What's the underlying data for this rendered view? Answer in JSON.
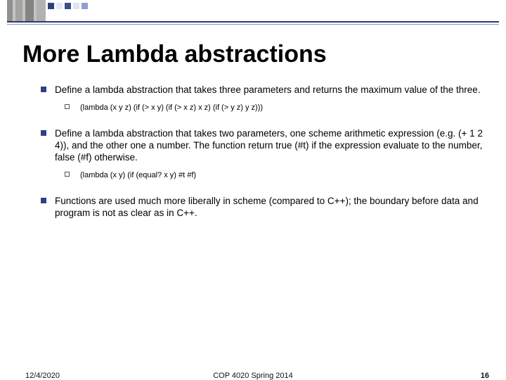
{
  "title": "More Lambda abstractions",
  "items": [
    {
      "text": "Define a lambda abstraction that takes three parameters and returns the maximum value of the three.",
      "sub": "(lambda (x y z) (if (> x y) (if (> x z) x z) (if (> y z) y z)))"
    },
    {
      "text": "Define a lambda abstraction that takes two parameters, one scheme arithmetic expression (e.g. (+ 1 2 4)), and the other one a number. The function return true (#t) if the expression evaluate to the number, false (#f) otherwise.",
      "sub": "(lambda (x y) (if (equal? x y) #t #f)"
    },
    {
      "text": "Functions are used much more liberally in scheme (compared to C++); the boundary before data and program is not as clear as in C++.",
      "sub": null
    }
  ],
  "footer": {
    "date": "12/4/2020",
    "course": "COP 4020 Spring 2014",
    "page": "16"
  }
}
